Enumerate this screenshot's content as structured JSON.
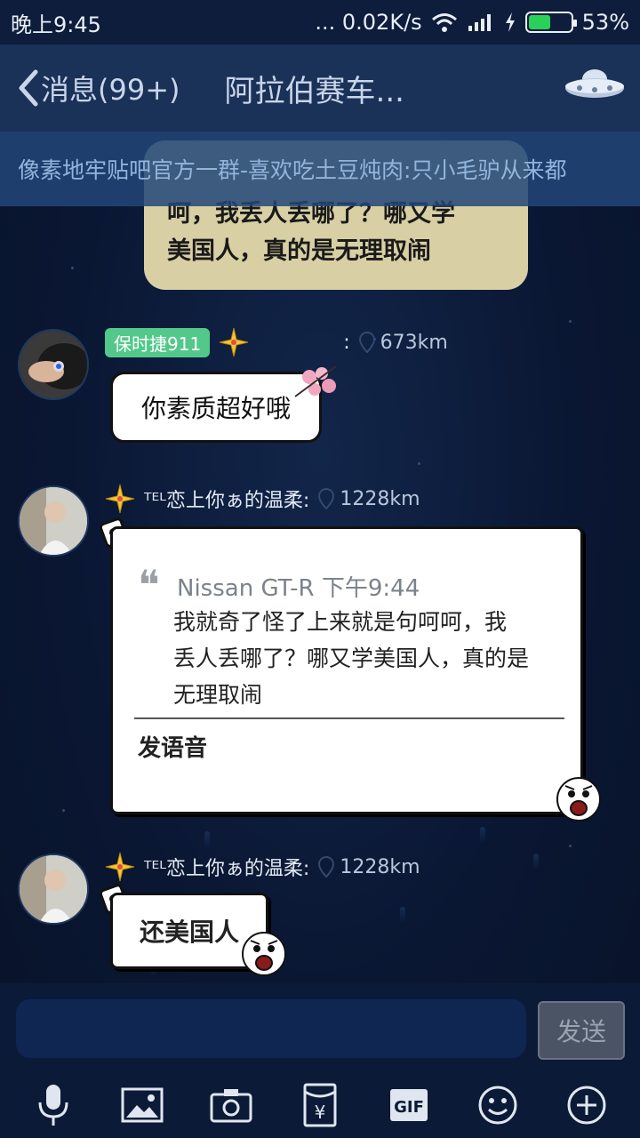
{
  "status_bar": {
    "time": "晚上9:45",
    "network_speed": "... 0.02K/s",
    "battery_percent": "53%",
    "battery_level": 0.53
  },
  "header": {
    "back_label": "消息(99+)",
    "title": "阿拉伯赛车...",
    "ufo_icon": "ufo-icon"
  },
  "notice": {
    "text": "像素地牢贴吧官方一群-喜欢吃土豆炖肉:只小毛驴从来都"
  },
  "messages": {
    "top_bubble": {
      "text_line1": "呵，我丢人丢哪了？哪又学",
      "text_line2": "美国人，真的是无理取闹"
    },
    "msg1": {
      "tag": "保时捷911",
      "separator": ":",
      "distance": "673km",
      "text": "你素质超好哦"
    },
    "msg2": {
      "sender": "ᵀᴱᴸ恋上你ぁ的温柔:",
      "distance": "1228km",
      "quote_author": "Nissan GT-R 下午9:44",
      "quote_line1": "我就奇了怪了上来就是句呵呵，我",
      "quote_line2": "丢人丢哪了？哪又学美国人，真的是",
      "quote_line3": "无理取闹",
      "reply": "发语音"
    },
    "msg3": {
      "sender": "ᵀᴱᴸ恋上你ぁ的温柔:",
      "distance": "1228km",
      "text": "还美国人"
    }
  },
  "input": {
    "send_label": "发送"
  },
  "colors": {
    "background": "#0b1a36",
    "header": "#1a3158",
    "tag_green": "#52c98a",
    "top_bubble": "#d8cfa4"
  }
}
